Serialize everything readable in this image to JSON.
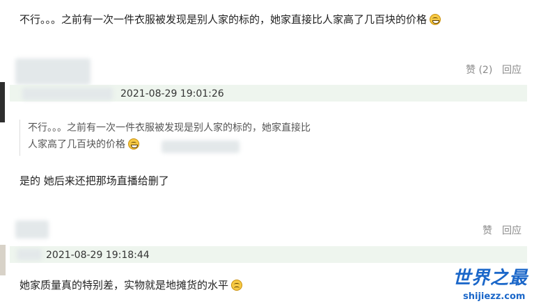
{
  "top_comment": {
    "text": "不行。。。之前有一次一件衣服被发现是别人家的标的，她家直接比人家高了几百块的价格",
    "emoji": "grinning-sweat-icon"
  },
  "reply1": {
    "like_label": "赞 (2)",
    "reply_label": "回应",
    "timestamp": "2021-08-29 19:01:26",
    "quote_line1": "不行。。。之前有一次一件衣服被发现是别人家的标的，她家直接比",
    "quote_line2": "人家高了几百块的价格",
    "body": "是的 她后来还把那场直播给删了"
  },
  "reply2": {
    "like_label": "赞",
    "reply_label": "回应",
    "timestamp": "2021-08-29 19:18:44",
    "body": "她家质量真的特别差，实物就是地摊货的水平"
  },
  "watermark": {
    "title": "世界之最",
    "url": "shijiezz.com"
  },
  "colors": {
    "band": "#eef5ee",
    "action": "#8a8a8a",
    "watermark": "#1b67c9"
  }
}
